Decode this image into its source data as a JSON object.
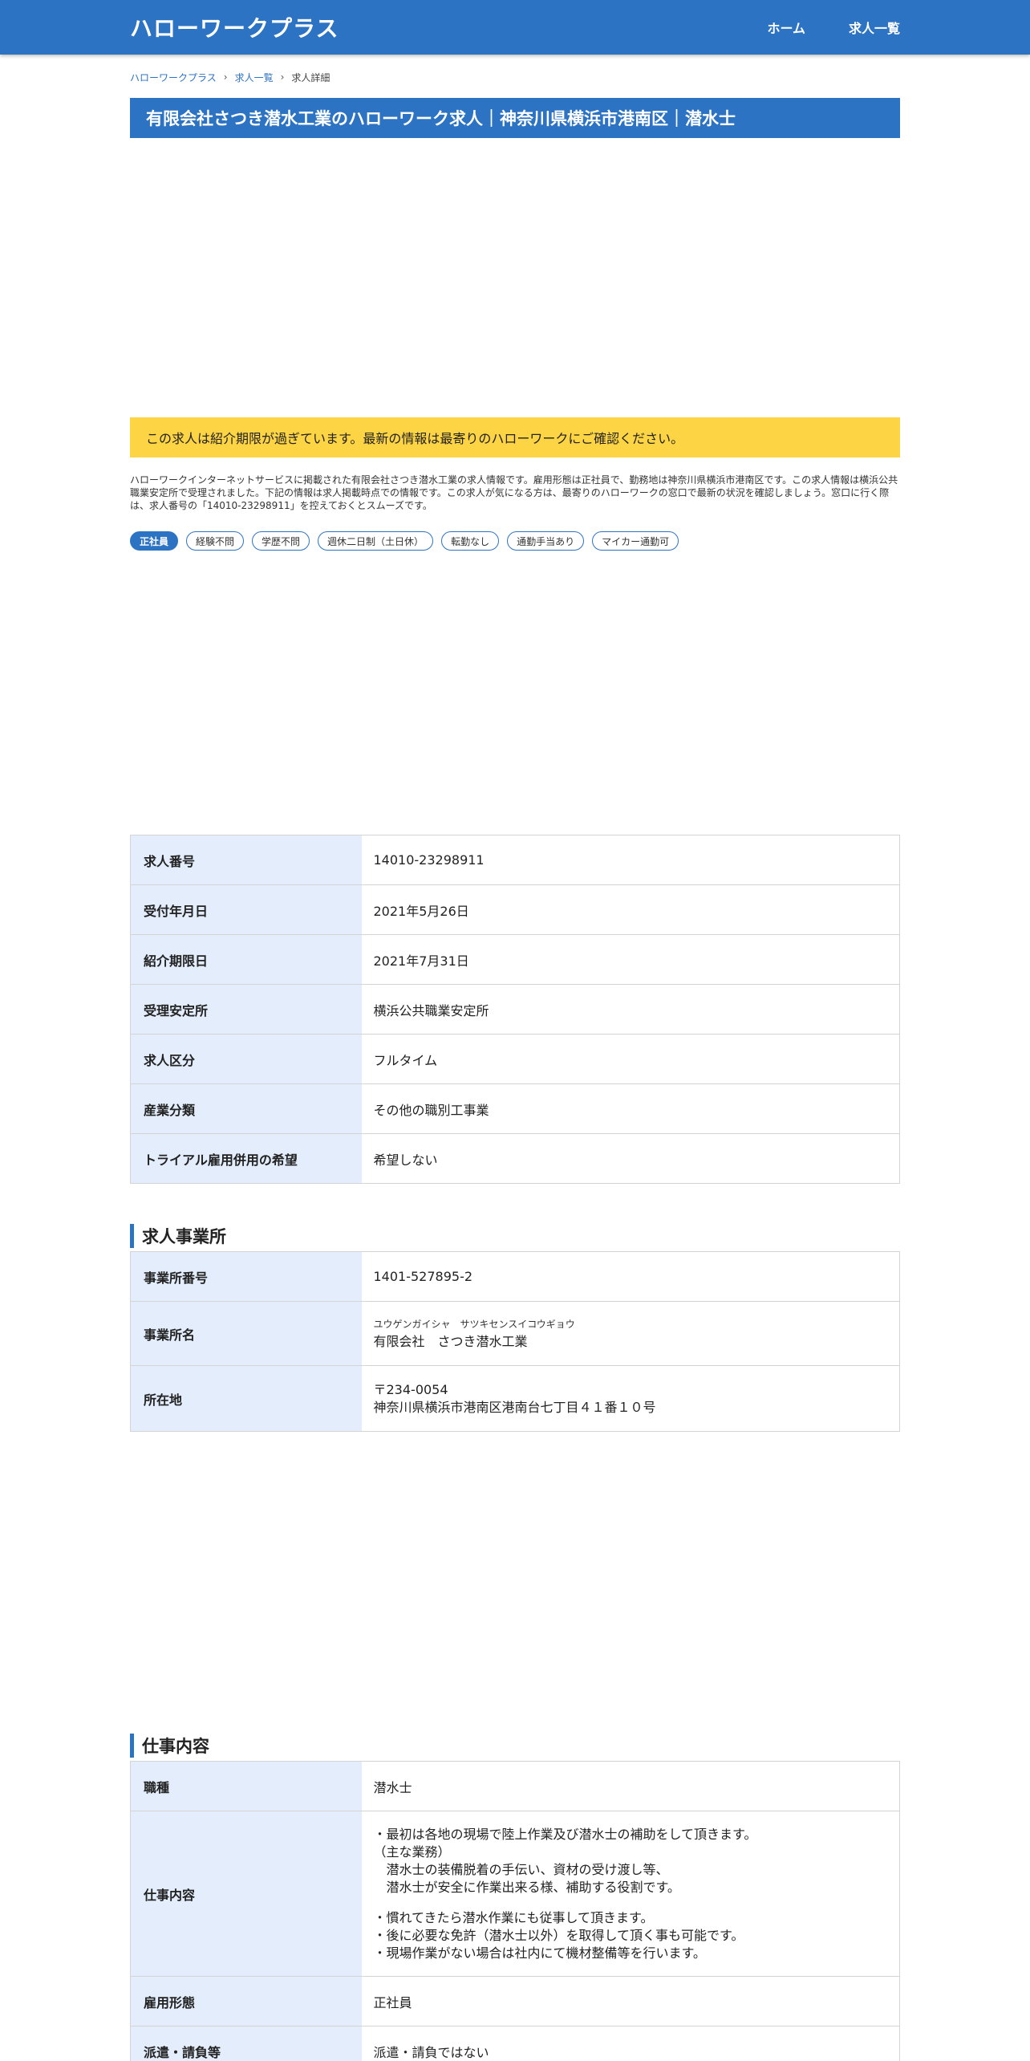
{
  "header": {
    "logo": "ハローワークプラス",
    "nav": [
      {
        "label": "ホーム"
      },
      {
        "label": "求人一覧"
      }
    ]
  },
  "breadcrumb": {
    "items": [
      "ハローワークプラス",
      "求人一覧"
    ],
    "current": "求人詳細"
  },
  "title": "有限会社さつき潜水工業のハローワーク求人｜神奈川県横浜市港南区｜潜水士",
  "notice": "この求人は紹介期限が過ぎています。最新の情報は最寄りのハローワークにご確認ください。",
  "intro": "ハローワークインターネットサービスに掲載された有限会社さつき潜水工業の求人情報です。雇用形態は正社員で、勤務地は神奈川県横浜市港南区です。この求人情報は横浜公共職業安定所で受理されました。下記の情報は求人掲載時点での情報です。この求人が気になる方は、最寄りのハローワークの窓口で最新の状況を確認しましょう。窓口に行く際は、求人番号の「14010-23298911」を控えておくとスムーズです。",
  "tags": [
    "正社員",
    "経験不問",
    "学歴不問",
    "週休二日制（土日休）",
    "転勤なし",
    "通勤手当あり",
    "マイカー通勤可"
  ],
  "basic_info": [
    {
      "label": "求人番号",
      "value": "14010-23298911"
    },
    {
      "label": "受付年月日",
      "value": "2021年5月26日"
    },
    {
      "label": "紹介期限日",
      "value": "2021年7月31日"
    },
    {
      "label": "受理安定所",
      "value": "横浜公共職業安定所"
    },
    {
      "label": "求人区分",
      "value": "フルタイム"
    },
    {
      "label": "産業分類",
      "value": "その他の職別工事業"
    },
    {
      "label": "トライアル雇用併用の希望",
      "value": "希望しない"
    }
  ],
  "office": {
    "heading": "求人事業所",
    "number_label": "事業所番号",
    "number": "1401-527895-2",
    "name_label": "事業所名",
    "name_kana": "ユウゲンガイシャ　サツキセンスイコウギョウ",
    "name": "有限会社　さつき潜水工業",
    "address_label": "所在地",
    "postal": "〒234-0054",
    "address": "神奈川県横浜市港南区港南台七丁目４１番１０号"
  },
  "job": {
    "heading": "仕事内容",
    "type_label": "職種",
    "type": "潜水士",
    "content_label": "仕事内容",
    "content_lines": [
      "・最初は各地の現場で陸上作業及び潜水士の補助をして頂きます。",
      "（主な業務）",
      "　潜水士の装備脱着の手伝い、資材の受け渡し等、",
      "　潜水士が安全に作業出来る様、補助する役割です。",
      "",
      "・慣れてきたら潜水作業にも従事して頂きます。",
      "・後に必要な免許（潜水士以外）を取得して頂く事も可能です。",
      "・現場作業がない場合は社内にて機材整備等を行います。"
    ],
    "employment_label": "雇用形態",
    "employment": "正社員",
    "dispatch_label": "派遣・請負等",
    "dispatch": "派遣・請負ではない"
  }
}
